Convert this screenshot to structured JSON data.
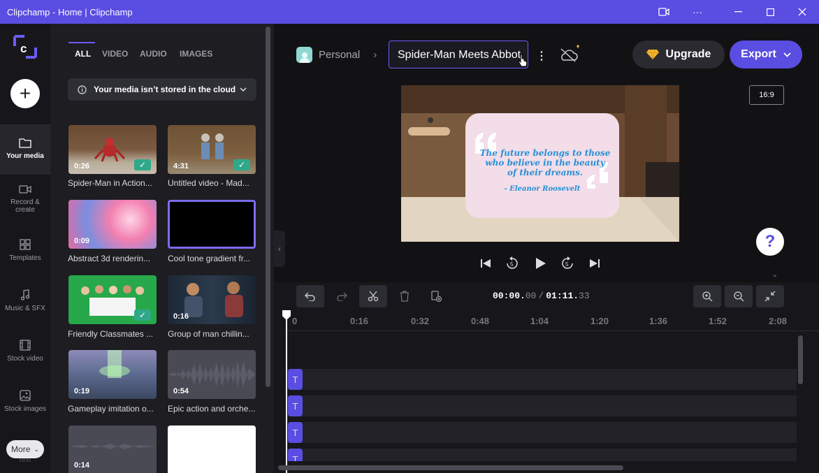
{
  "window": {
    "title": "Clipchamp - Home | Clipchamp"
  },
  "rail": {
    "items": [
      {
        "label": "Your media"
      },
      {
        "label": "Record & create"
      },
      {
        "label": "Templates"
      },
      {
        "label": "Music & SFX"
      },
      {
        "label": "Stock video"
      },
      {
        "label": "Stock images"
      }
    ],
    "more": "More",
    "text_partial": "Text"
  },
  "media": {
    "tabs": [
      "ALL",
      "VIDEO",
      "AUDIO",
      "IMAGES"
    ],
    "notice": "Your media isn’t stored in the cloud",
    "items": [
      {
        "duration": "0:26",
        "caption": "Spider-Man in Action..."
      },
      {
        "duration": "4:31",
        "caption": "Untitled video - Mad..."
      },
      {
        "duration": "0:09",
        "caption": "Abstract 3d renderin..."
      },
      {
        "duration": "",
        "caption": "Cool tone gradient fr..."
      },
      {
        "duration": "",
        "caption": "Friendly Classmates ..."
      },
      {
        "duration": "0:16",
        "caption": "Group of man chillin..."
      },
      {
        "duration": "0:19",
        "caption": "Gameplay imitation o..."
      },
      {
        "duration": "0:54",
        "caption": "Epic action and orche..."
      },
      {
        "duration": "0:14",
        "caption": ""
      },
      {
        "duration": "",
        "caption": ""
      }
    ]
  },
  "header": {
    "workspace": "Personal",
    "project_name": "Spider-Man Meets Abbot",
    "upgrade": "Upgrade",
    "export": "Export",
    "ratio": "16:9"
  },
  "preview": {
    "quote": "The future belongs to those who believe in the beauty of their dreams.",
    "author": "- Eleanor Roosevelt"
  },
  "help": "?",
  "timeline": {
    "time_current_a": "00:00.",
    "time_current_b": "00",
    "sep": "/",
    "time_total_a": "01:11.",
    "time_total_b": "33",
    "ticks": [
      "0",
      "0:16",
      "0:32",
      "0:48",
      "1:04",
      "1:20",
      "1:36",
      "1:52",
      "2:08"
    ],
    "clip_glyph": "T"
  },
  "colors": {
    "accent": "#5a4de1",
    "check": "#2fa98a",
    "quote": "#2a8fd8"
  }
}
